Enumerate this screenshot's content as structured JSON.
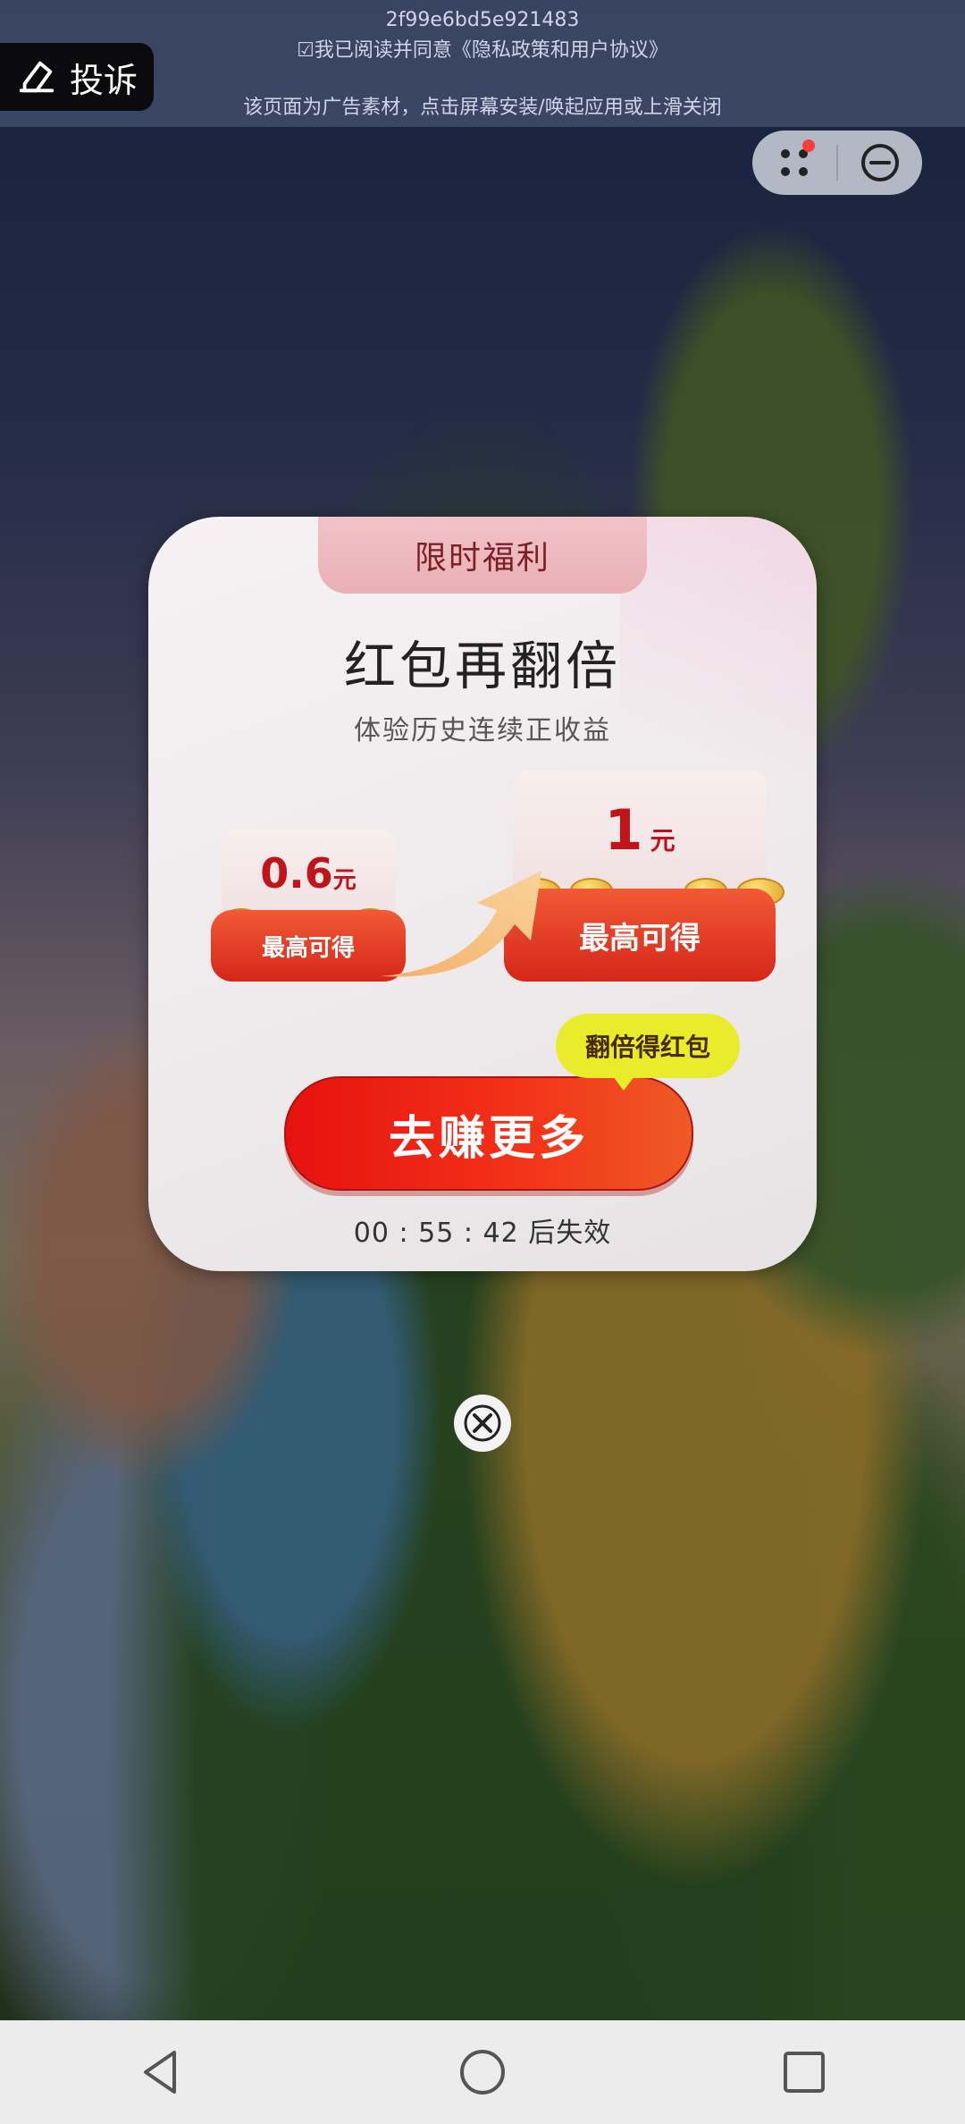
{
  "top_banner": {
    "ad_id": "2f99e6bd5e921483",
    "agreement": "☑我已阅读并同意《隐私政策和用户协议》",
    "hint": "该页面为广告素材，点击屏幕安装/唤起应用或上滑关闭"
  },
  "complain_button": {
    "label": "投诉"
  },
  "dialog": {
    "tag": "限时福利",
    "title": "红包再翻倍",
    "subtitle": "体验历史连续正收益",
    "envelope_left": {
      "amount": "0.6",
      "unit": "元",
      "label": "最高可得"
    },
    "envelope_right": {
      "amount": "1",
      "unit": "元",
      "label": "最高可得"
    },
    "bubble": "翻倍得红包",
    "cta": "去赚更多",
    "countdown": "00 : 55 : 42 后失效"
  },
  "colors": {
    "accent_red": "#e6120f",
    "tag_pink": "#f0c3c7",
    "bubble_yellow": "#e8ec2a"
  },
  "icons": [
    "edit-icon",
    "more-dots-icon",
    "minus-circle-icon",
    "close-icon",
    "back-icon",
    "home-icon",
    "recents-icon"
  ]
}
